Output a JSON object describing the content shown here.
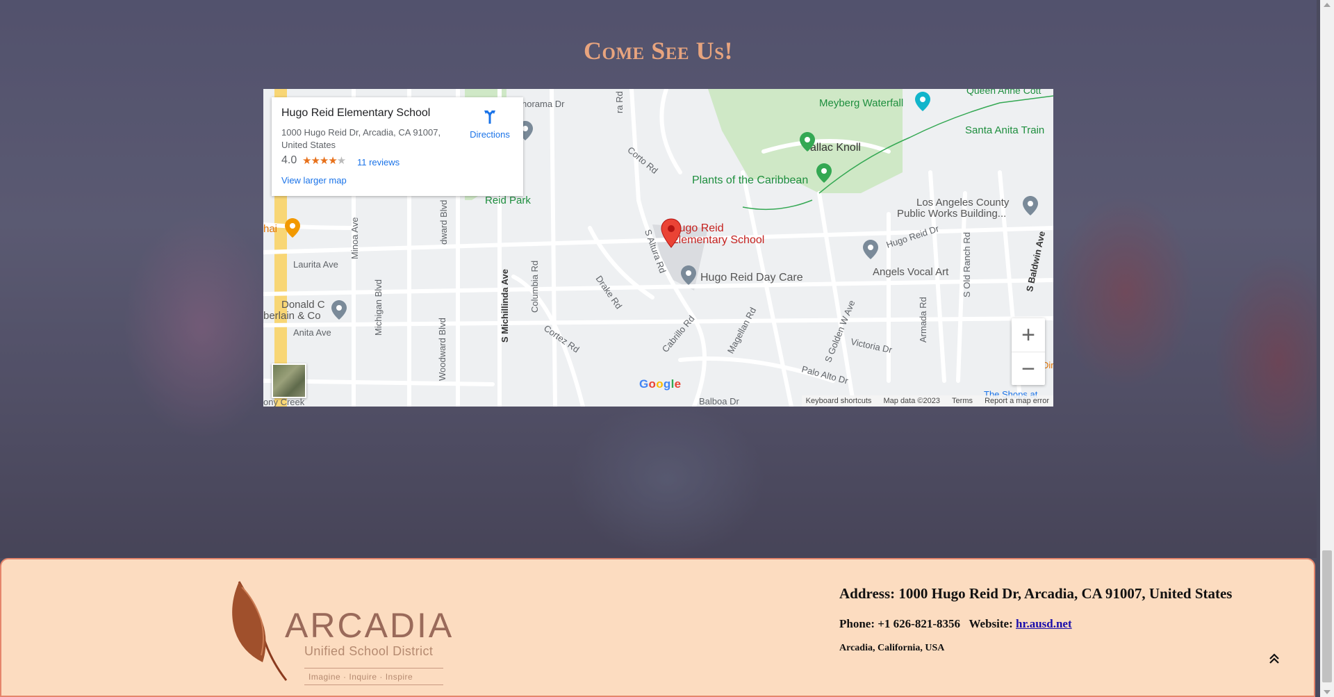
{
  "section": {
    "title": "Come See Us!"
  },
  "map": {
    "info_card": {
      "name": "Hugo Reid Elementary School",
      "address": "1000 Hugo Reid Dr, Arcadia, CA 91007, United States",
      "rating": "4.0",
      "stars_filled": 4,
      "stars_total": 5,
      "reviews": "11 reviews",
      "larger_map": "View larger map",
      "directions": "Directions"
    },
    "labels": {
      "meyberg": "Meyberg Waterfall",
      "queen_anne": "Queen Anne Cott",
      "santa_anita": "Santa Anita Train",
      "tallac": "Tallac Knoll",
      "plants": "Plants of the Caribbean",
      "la_county": "Los Angeles County",
      "la_county2": "Public Works Building...",
      "reid_park": "Reid Park",
      "panorama": "norama Dr",
      "corto": "Corto Rd",
      "hugo_reid_dr": "Hugo Reid Dr",
      "angels": "Angels Vocal Art",
      "day_care": "Hugo Reid Day Care",
      "pin_line1": "Hugo Reid",
      "pin_line2": "Elementary School",
      "laurita": "Laurita Ave",
      "anita": "Anita Ave",
      "donald1": "Donald C",
      "donald2": "berlain & Co",
      "thai": "hai",
      "drake": "Drake Rd",
      "cortez": "Cortez Rd",
      "cabrillo": "Cabrillo Rd",
      "magellan": "Magellan Rd",
      "victoria": "Victoria Dr",
      "palo_alto": "Palo Alto Dr",
      "balboa": "Balboa Dr",
      "pony_creek": "ony Creek",
      "s_altura": "S Altura Rd",
      "ra_rd": "ra Rd",
      "s_michillinda": "S Michillinda Ave",
      "columbia": "Columbia Rd",
      "minoa": "Minoa Ave",
      "michigan": "Michigan Blvd",
      "woodward": "Woodward Blvd",
      "dward": "dward Blvd",
      "golden": "S Golden W Ave",
      "armada": "Armada Rd",
      "old_ranch": "S Old Ranch Rd",
      "baldwin": "S Baldwin Ave",
      "the_shops": "The Shops at",
      "dir": "Dir"
    },
    "google": "Google",
    "attribution": [
      "Keyboard shortcuts",
      "Map data ©2023",
      "Terms",
      "Report a map error"
    ],
    "zoom_in": "+",
    "zoom_out": "−"
  },
  "footer": {
    "logo": {
      "wordmark": "ARCADIA",
      "subtitle": "Unified School District",
      "tagline": "Imagine · Inquire · Inspire"
    },
    "address": "Address: 1000 Hugo Reid Dr, Arcadia, CA 91007, United States",
    "phone": "Phone: +1 626-821-8356",
    "website_label": "Website:",
    "website": "hr.ausd.net",
    "location": "Arcadia, California, USA"
  },
  "colors": {
    "title": "#e8a47e",
    "footer_bg": "#fcdcc0",
    "footer_border": "#e5856b",
    "link": "#1a0dab",
    "map_pin": "#ea4335"
  },
  "icons": [
    "directions-icon",
    "map-pin-icon",
    "scroll-to-top-icon",
    "feather-logo-icon"
  ]
}
